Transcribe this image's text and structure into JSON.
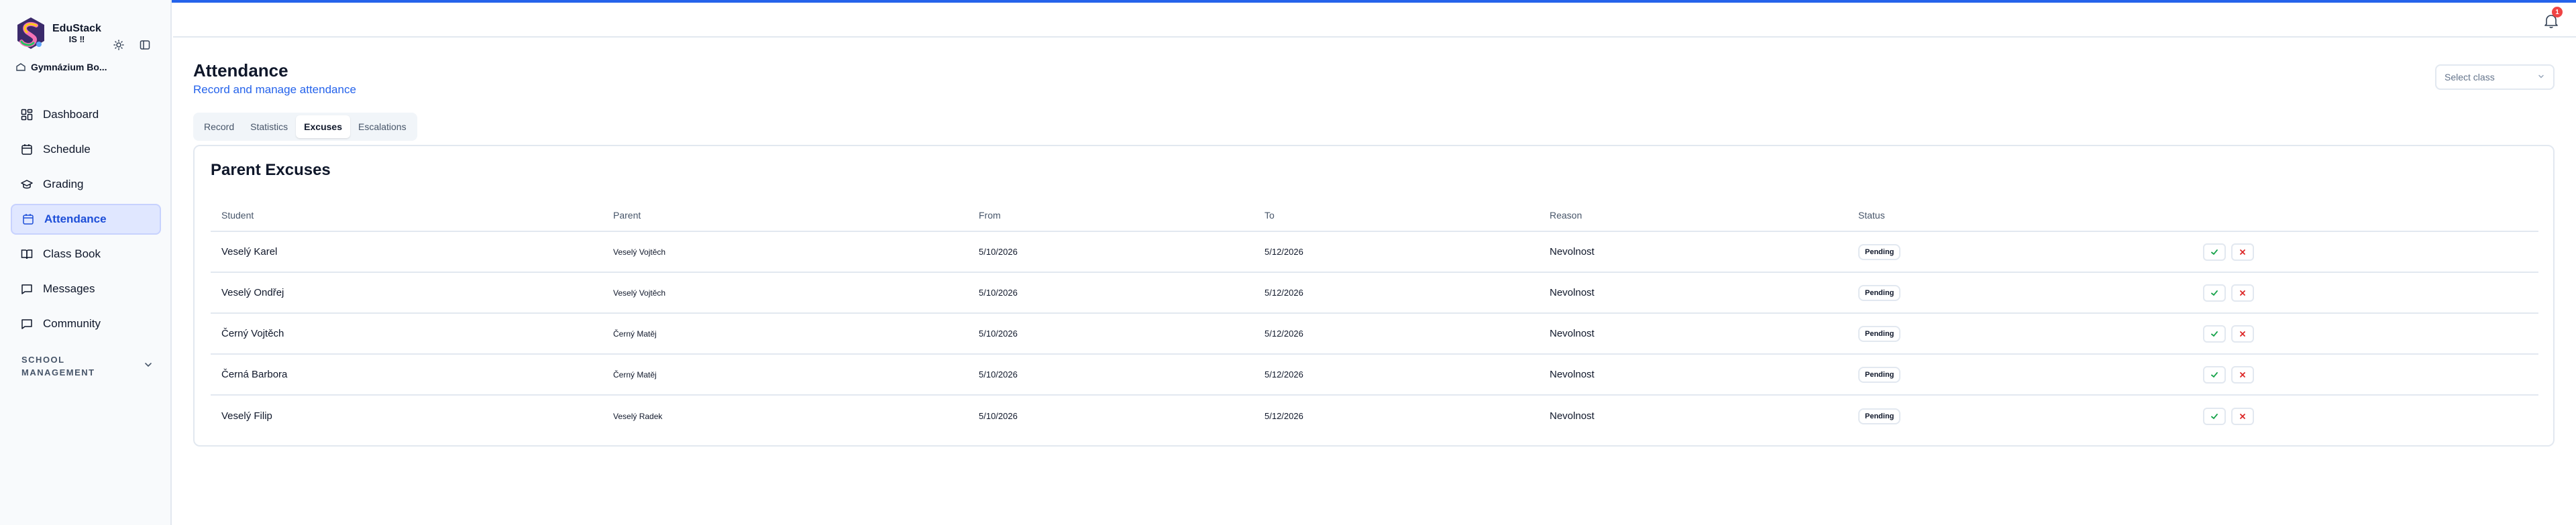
{
  "app": {
    "name": "EduStack",
    "sub": "IS ‼",
    "school": "Gymnázium Bo..."
  },
  "sidebar": {
    "items": [
      {
        "label": "Dashboard",
        "icon": "dashboard-icon"
      },
      {
        "label": "Schedule",
        "icon": "calendar-icon"
      },
      {
        "label": "Grading",
        "icon": "graduation-cap-icon"
      },
      {
        "label": "Attendance",
        "icon": "calendar-check-icon",
        "active": true
      },
      {
        "label": "Class Book",
        "icon": "book-icon"
      },
      {
        "label": "Messages",
        "icon": "message-icon"
      },
      {
        "label": "Community",
        "icon": "chat-icon"
      }
    ],
    "section_label": "SCHOOL MANAGEMENT"
  },
  "header": {
    "notification_count": "1"
  },
  "page": {
    "title": "Attendance",
    "subtitle": "Record and manage attendance",
    "class_select_placeholder": "Select class"
  },
  "tabs": [
    {
      "label": "Record"
    },
    {
      "label": "Statistics"
    },
    {
      "label": "Excuses",
      "active": true
    },
    {
      "label": "Escalations"
    }
  ],
  "excuses": {
    "title": "Parent Excuses",
    "columns": {
      "student": "Student",
      "parent": "Parent",
      "from": "From",
      "to": "To",
      "reason": "Reason",
      "status": "Status"
    },
    "rows": [
      {
        "student": "Veselý Karel",
        "parent": "Veselý Vojtěch",
        "from": "5/10/2026",
        "to": "5/12/2026",
        "reason": "Nevolnost",
        "status": "Pending"
      },
      {
        "student": "Veselý Ondřej",
        "parent": "Veselý Vojtěch",
        "from": "5/10/2026",
        "to": "5/12/2026",
        "reason": "Nevolnost",
        "status": "Pending"
      },
      {
        "student": "Černý Vojtěch",
        "parent": "Černý Matěj",
        "from": "5/10/2026",
        "to": "5/12/2026",
        "reason": "Nevolnost",
        "status": "Pending"
      },
      {
        "student": "Černá Barbora",
        "parent": "Černý Matěj",
        "from": "5/10/2026",
        "to": "5/12/2026",
        "reason": "Nevolnost",
        "status": "Pending"
      },
      {
        "student": "Veselý Filip",
        "parent": "Veselý Radek",
        "from": "5/10/2026",
        "to": "5/12/2026",
        "reason": "Nevolnost",
        "status": "Pending"
      }
    ]
  },
  "colors": {
    "accent": "#2563eb",
    "approve": "#16a34a",
    "reject": "#dc2626",
    "active_nav_bg": "#e0e7ff"
  }
}
